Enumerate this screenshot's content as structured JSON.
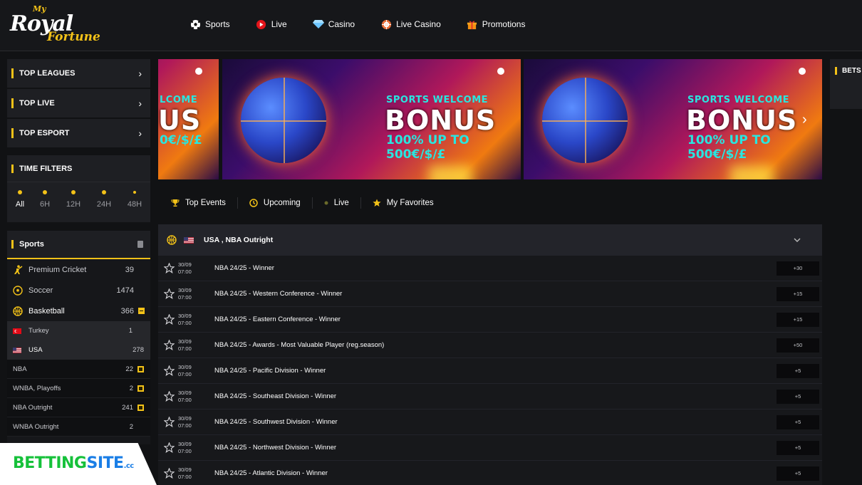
{
  "brand": {
    "my": "My",
    "royal": "Royal",
    "fortune": "Fortune"
  },
  "nav": [
    {
      "label": "Sports",
      "icon": "soccer-ball-icon"
    },
    {
      "label": "Live",
      "icon": "live-play-icon"
    },
    {
      "label": "Casino",
      "icon": "diamond-icon"
    },
    {
      "label": "Live Casino",
      "icon": "roulette-icon"
    },
    {
      "label": "Promotions",
      "icon": "gift-icon"
    }
  ],
  "sidebar": {
    "blocks": [
      {
        "label": "TOP LEAGUES"
      },
      {
        "label": "TOP LIVE"
      },
      {
        "label": "TOP ESPORT"
      }
    ],
    "time_filters": {
      "title": "TIME FILTERS",
      "items": [
        "All",
        "6H",
        "12H",
        "24H",
        "48H"
      ],
      "active": "All"
    },
    "sports": {
      "title": "Sports",
      "rows": [
        {
          "name": "Premium Cricket",
          "count": "39"
        },
        {
          "name": "Soccer",
          "count": "1474"
        },
        {
          "name": "Basketball",
          "count": "366"
        }
      ],
      "countries": [
        {
          "name": "Turkey",
          "count": "1"
        },
        {
          "name": "USA",
          "count": "278"
        }
      ],
      "leagues": [
        {
          "name": "NBA",
          "count": "22"
        },
        {
          "name": "WNBA, Playoffs",
          "count": "2"
        },
        {
          "name": "NBA Outright",
          "count": "241"
        },
        {
          "name": "WNBA Outright",
          "count": "2"
        }
      ]
    }
  },
  "banner": {
    "line1": "SPORTS WELCOME",
    "line2": "BONUS",
    "line3": "100% UP TO 500€/$/£",
    "partial_line1": "LCOME",
    "partial_line2": "US",
    "partial_line3": "0€/$/£"
  },
  "tabs": [
    {
      "label": "Top Events",
      "icon": "trophy-icon"
    },
    {
      "label": "Upcoming",
      "icon": "clock-icon"
    },
    {
      "label": "Live",
      "icon": "live-dot-icon"
    },
    {
      "label": "My Favorites",
      "icon": "star-icon"
    }
  ],
  "events": {
    "header": "USA , NBA Outright",
    "rows": [
      {
        "date": "30/09",
        "time": "07:00",
        "name": "NBA 24/25 - Winner",
        "odds": "+30"
      },
      {
        "date": "30/09",
        "time": "07:00",
        "name": "NBA 24/25 - Western Conference - Winner",
        "odds": "+15"
      },
      {
        "date": "30/09",
        "time": "07:00",
        "name": "NBA 24/25 - Eastern Conference - Winner",
        "odds": "+15"
      },
      {
        "date": "30/09",
        "time": "07:00",
        "name": "NBA 24/25 - Awards - Most Valuable Player (reg.season)",
        "odds": "+50"
      },
      {
        "date": "30/09",
        "time": "07:00",
        "name": "NBA 24/25 - Pacific Division - Winner",
        "odds": "+5"
      },
      {
        "date": "30/09",
        "time": "07:00",
        "name": "NBA 24/25 - Southeast Division - Winner",
        "odds": "+5"
      },
      {
        "date": "30/09",
        "time": "07:00",
        "name": "NBA 24/25 - Southwest Division - Winner",
        "odds": "+5"
      },
      {
        "date": "30/09",
        "time": "07:00",
        "name": "NBA 24/25 - Northwest Division - Winner",
        "odds": "+5"
      },
      {
        "date": "30/09",
        "time": "07:00",
        "name": "NBA 24/25 - Atlantic Division - Winner",
        "odds": "+5"
      }
    ]
  },
  "bets": {
    "label": "BETS"
  },
  "watermark": {
    "part1": "BETTING",
    "part2": "SITE",
    "part3": ".cc"
  },
  "colors": {
    "accent": "#f3c218",
    "background": "#111214",
    "panel": "#1e1f23"
  }
}
